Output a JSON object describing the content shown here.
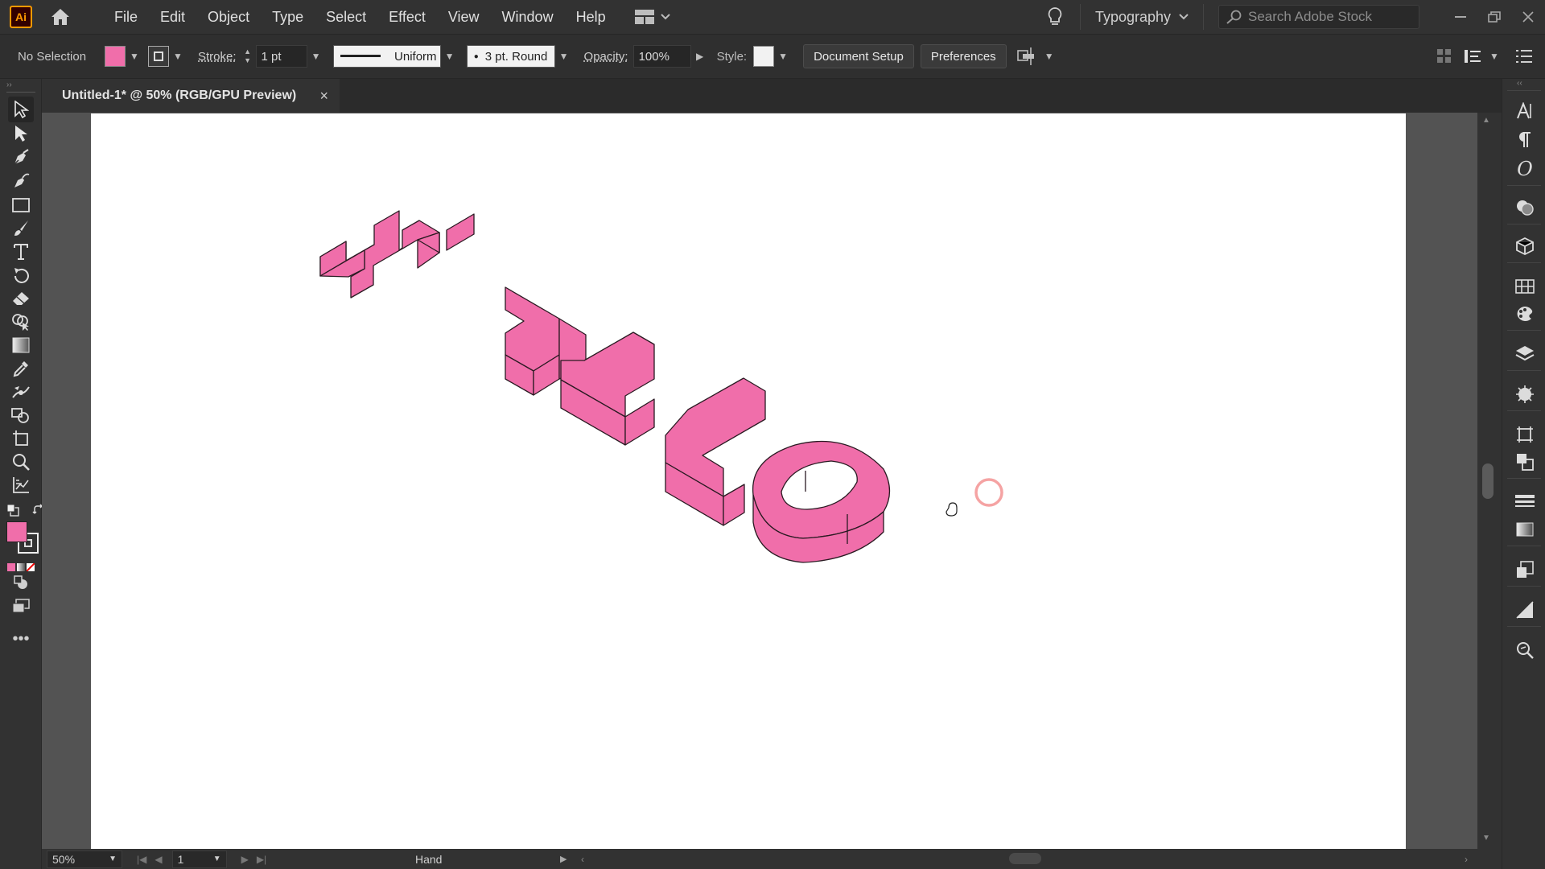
{
  "app": {
    "logo_text": "Ai",
    "menu": [
      "File",
      "Edit",
      "Object",
      "Type",
      "Select",
      "Effect",
      "View",
      "Window",
      "Help"
    ],
    "workspace": "Typography",
    "stock_search_placeholder": "Search Adobe Stock",
    "window_controls": [
      "minimize",
      "restore",
      "close"
    ]
  },
  "control_bar": {
    "selection_label": "No Selection",
    "fill_color": "#f06eaa",
    "stroke_label": "Stroke:",
    "stroke_weight": "1 pt",
    "stroke_profile": "Uniform",
    "brush": "3 pt. Round",
    "opacity_label": "Opacity:",
    "opacity_value": "100%",
    "style_label": "Style:",
    "document_setup": "Document Setup",
    "preferences": "Preferences"
  },
  "document": {
    "tab_title": "Untitled-1* @ 50% (RGB/GPU Preview)",
    "close_glyph": "×",
    "artwork_text": "HELLO",
    "artwork_color": "#f06eaa",
    "artwork_stroke": "#2a1a22"
  },
  "tools": [
    "selection-tool",
    "direct-selection-tool",
    "pen-tool",
    "curvature-tool",
    "rectangle-tool",
    "paintbrush-tool",
    "type-tool",
    "rotate-tool",
    "eraser-tool",
    "shape-builder-tool",
    "gradient-tool",
    "eyedropper-tool",
    "puppet-warp-tool",
    "shaper-tool",
    "artboard-tool",
    "zoom-tool",
    "graph-tool"
  ],
  "status_bar": {
    "zoom": "50%",
    "page": "1",
    "current_tool": "Hand"
  }
}
